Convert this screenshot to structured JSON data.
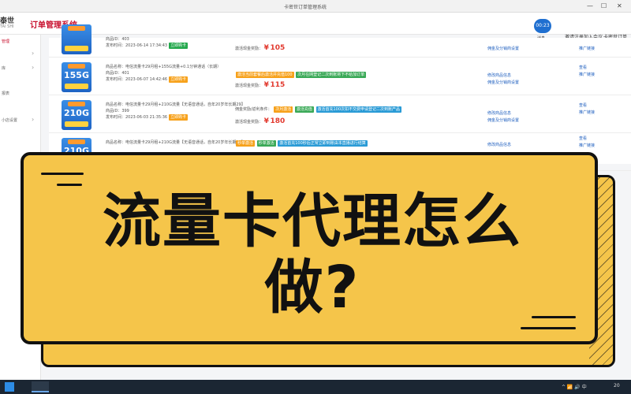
{
  "browser": {
    "tab_title": "卡密世订单管理系统",
    "win_buttons": [
      "—",
      "☐",
      "✕"
    ]
  },
  "header": {
    "logo_main": "泰世",
    "logo_sub": "TAI SHI",
    "app_title": "订单管理系统",
    "clock_badge": "00:23",
    "message_label": "消息",
    "links": [
      "邀请注册加入会议",
      "卡密世订单"
    ]
  },
  "sidebar": {
    "items": [
      {
        "label": "管理",
        "chevron": ""
      },
      {
        "label": "库",
        "chevron": "›"
      },
      {
        "label": "",
        "chevron": "›"
      },
      {
        "label": "报表",
        "chevron": ""
      },
      {
        "label": "小店设置",
        "chevron": "›"
      }
    ]
  },
  "rows": [
    {
      "thumb_big": "",
      "id": "商品ID：403",
      "name": "",
      "time": "发布时间：2023-06-14 17:34:43",
      "status": "立即购卡",
      "status_color": "green",
      "reward_label": "激活现金奖励：",
      "reward_prefix": "¥",
      "reward": "105",
      "conditions": [],
      "policy": [
        "佣金及分销商设置"
      ],
      "actions": [
        "推广链接"
      ]
    },
    {
      "thumb_big": "155G",
      "id": "商品ID：401",
      "name": "商品名称：电信流量卡29月租+155G流量+0.1分钟通话（长期）",
      "time": "发布时间：2023-06-07 14:42:46",
      "status": "立即购卡",
      "status_color": "orange",
      "reward_label": "激活现金奖励：",
      "reward_prefix": "¥",
      "reward": "115",
      "conditions": [
        {
          "text": "激活当前套餐后激活并充值100",
          "color": "orange"
        },
        {
          "text": "次月在网登记二次到账将下不给加订单",
          "color": "green"
        }
      ],
      "policy": [
        "修改商品信息",
        "佣金及分销商设置"
      ],
      "actions": [
        "查看",
        "推广链接"
      ]
    },
    {
      "thumb_big": "210G",
      "id": "商品ID：399",
      "name": "商品名称：电信流量卡29月租+210G流量【无语音通话，自年20岁年长期29】",
      "time": "发布时间：2023-06-03 21:35:36",
      "status": "立即购卡",
      "status_color": "orange",
      "reward_label": "激活现金奖励：",
      "reward_prefix": "¥",
      "reward": "180",
      "conditions": [
        {
          "text": "次月激活",
          "color": "orange"
        },
        {
          "text": "激活充值",
          "color": "green"
        },
        {
          "text": "激活首充100次扣不交费申请登记二次到账产品",
          "color": "blue"
        }
      ],
      "condition_prefix": "佣金奖励/返利条件：",
      "policy": [
        "修改商品信息",
        "佣金及分销商设置"
      ],
      "actions": [
        "查看",
        "推广链接"
      ]
    },
    {
      "thumb_big": "210G",
      "id": "",
      "name": "商品名称：电信流量卡29月租+210G流量【无语音通话，自年20岁年长期29】",
      "time": "",
      "status": "",
      "status_color": "orange",
      "reward_label": "",
      "reward_prefix": "",
      "reward": "",
      "conditions": [
        {
          "text": "秒单激活",
          "color": "orange"
        },
        {
          "text": "秒单激活",
          "color": "green"
        },
        {
          "text": "激活首充100秒后正常立即到账由本直播进行结算",
          "color": "blue"
        }
      ],
      "policy": [
        "修改商品信息"
      ],
      "actions": [
        "查看",
        "推广链接"
      ]
    }
  ],
  "banner": {
    "line1": "流量卡代理怎么",
    "line2": "做?"
  },
  "taskbar": {
    "tray": "^ 📶 🔊 中",
    "clock": "20"
  }
}
